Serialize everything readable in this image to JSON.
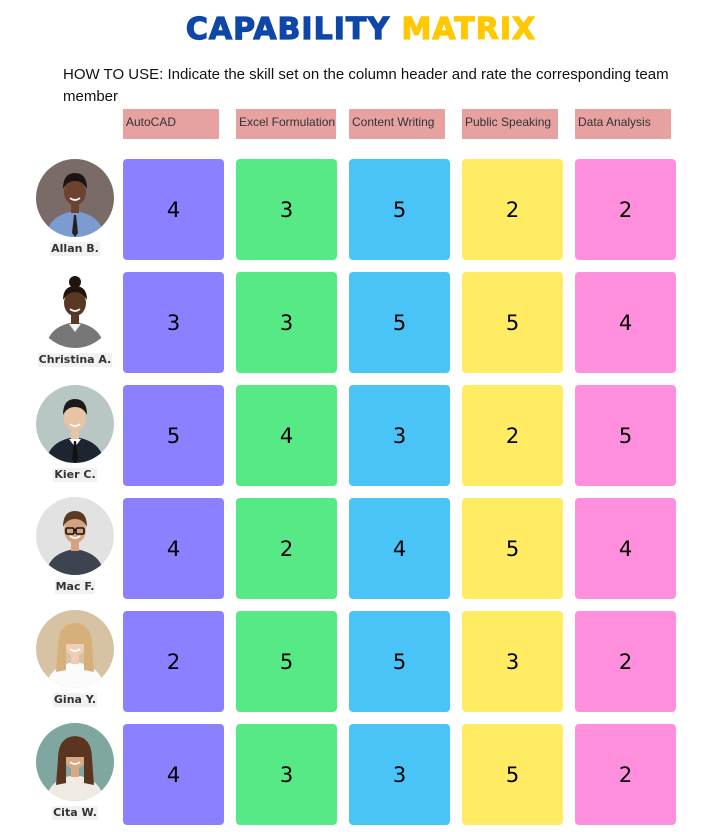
{
  "title": {
    "part1": "CAPABILITY",
    "part2": "MATRIX"
  },
  "instructions": "HOW TO USE: Indicate the skill set on the column header and rate the corresponding team member",
  "colors": {
    "title_blue": "#0f47a8",
    "title_yellow": "#ffc800",
    "header_bg": "#e8a1a1",
    "columns": [
      "#8b80ff",
      "#57e985",
      "#4ac3f7",
      "#ffec62",
      "#ff8fdd"
    ]
  },
  "skills": [
    "AutoCAD",
    "Excel Formulation",
    "Content Writing",
    "Public Speaking",
    "Data Analysis"
  ],
  "members": [
    {
      "name": "Allan B.",
      "avatar": "man-smiling-blue-shirt-tie",
      "ratings": [
        4,
        3,
        5,
        2,
        2
      ]
    },
    {
      "name": "Christina A.",
      "avatar": "woman-gray-blazer",
      "ratings": [
        3,
        3,
        5,
        5,
        4
      ]
    },
    {
      "name": "Kier C.",
      "avatar": "man-dark-suit-tie",
      "ratings": [
        5,
        4,
        3,
        2,
        5
      ]
    },
    {
      "name": "Mac F.",
      "avatar": "man-glasses-beard",
      "ratings": [
        4,
        2,
        4,
        5,
        4
      ]
    },
    {
      "name": "Gina Y.",
      "avatar": "woman-blonde-white-blouse",
      "ratings": [
        2,
        5,
        5,
        3,
        2
      ]
    },
    {
      "name": "Cita W.",
      "avatar": "woman-brown-hair-smiling",
      "ratings": [
        4,
        3,
        3,
        5,
        2
      ]
    }
  ]
}
